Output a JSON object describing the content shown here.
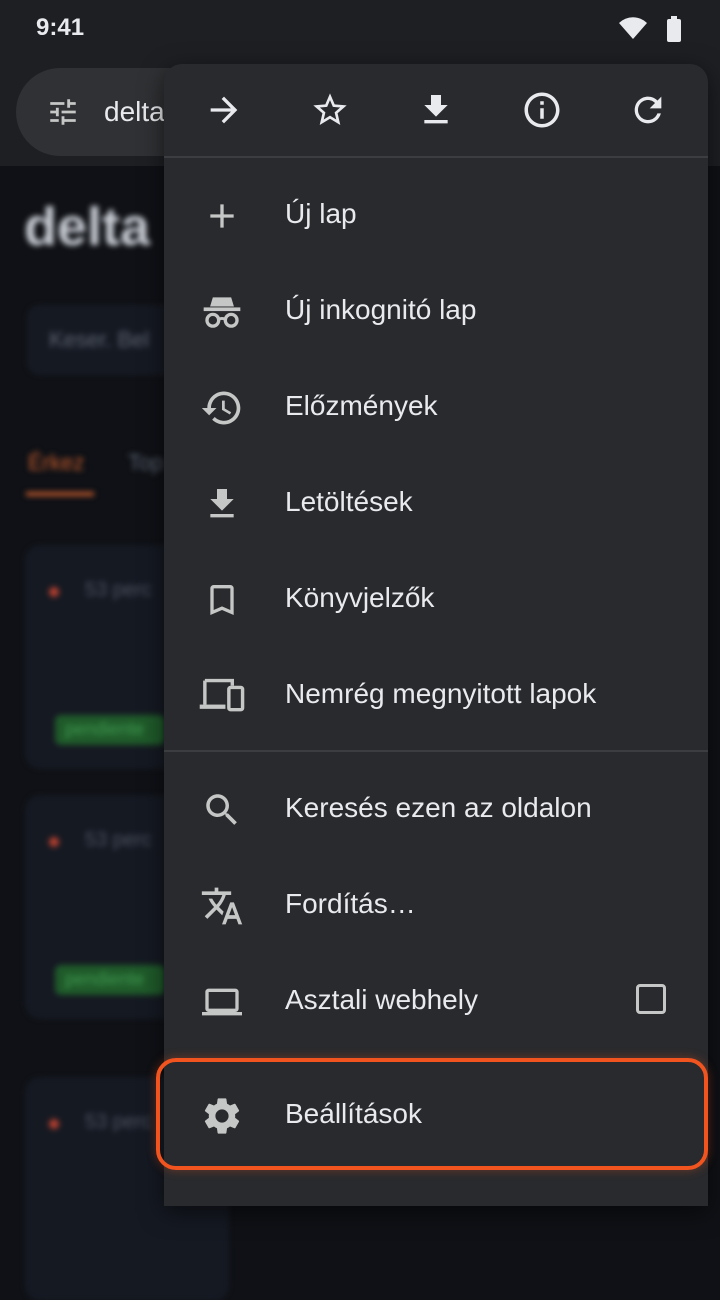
{
  "status_bar": {
    "time": "9:41"
  },
  "address_bar": {
    "url": "delta"
  },
  "background_page": {
    "logo": "delta",
    "search_placeholder": "Keser. Bel",
    "tabs": [
      "Érkez",
      "Top"
    ],
    "cards": [
      {
        "text": "53 perc",
        "badge": "pendiente"
      },
      {
        "text": "53 perc",
        "badge": "pendiente"
      },
      {
        "text": "53 perc",
        "badge": ""
      }
    ]
  },
  "menu": {
    "top_icons": [
      "forward-icon",
      "bookmark-star-icon",
      "download-icon",
      "info-icon",
      "reload-icon"
    ],
    "items": [
      {
        "label": "Új lap",
        "icon": "plus-icon"
      },
      {
        "label": "Új inkognitó lap",
        "icon": "incognito-icon"
      },
      {
        "label": "Előzmények",
        "icon": "history-icon"
      },
      {
        "label": "Letöltések",
        "icon": "download-icon"
      },
      {
        "label": "Könyvjelzők",
        "icon": "bookmark-icon"
      },
      {
        "label": "Nemrég megnyitott lapok",
        "icon": "devices-icon"
      },
      {
        "label": "Keresés ezen az oldalon",
        "icon": "search-icon"
      },
      {
        "label": "Fordítás…",
        "icon": "translate-icon"
      },
      {
        "label": "Asztali webhely",
        "icon": "laptop-icon",
        "checked": false
      },
      {
        "label": "Beállítások",
        "icon": "gear-icon",
        "highlighted": true
      }
    ]
  },
  "colors": {
    "menu_bg": "#292a2d",
    "highlight": "#f1541e",
    "text": "#e8eaed"
  }
}
